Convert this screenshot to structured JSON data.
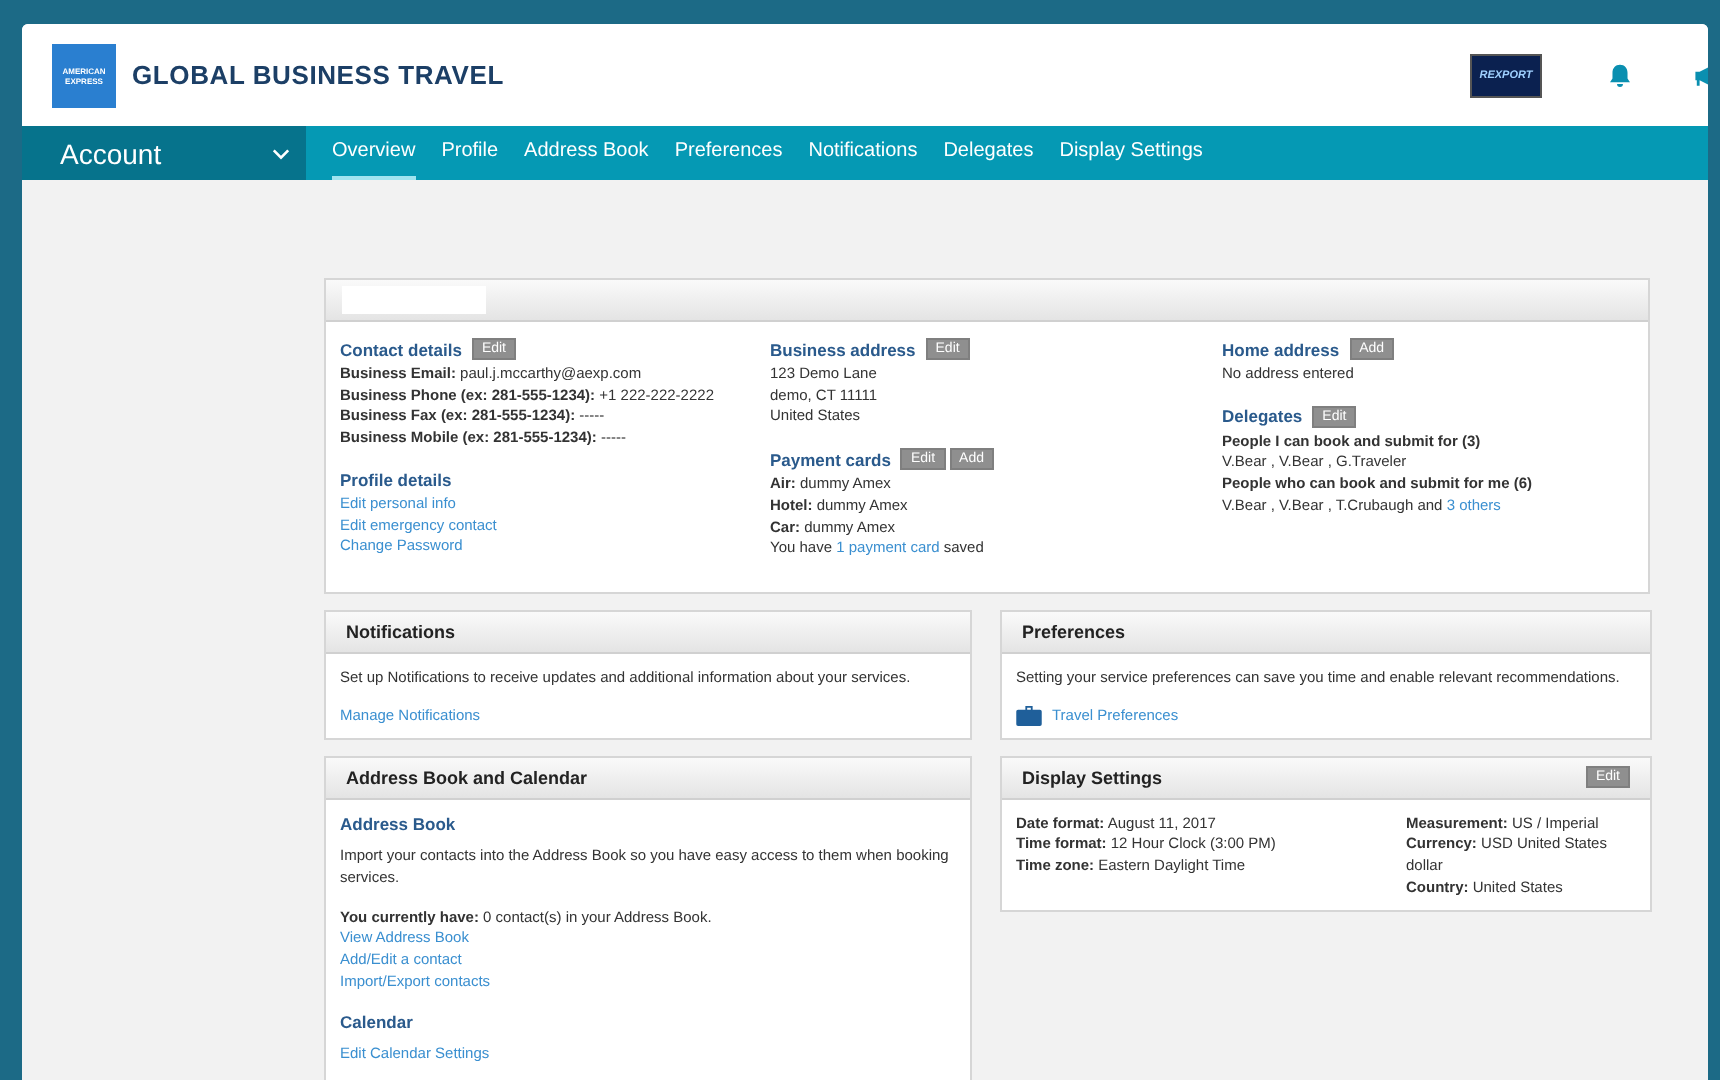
{
  "header": {
    "logo_lines": [
      "AMERICAN",
      "EXPRESS"
    ],
    "brand": "GLOBAL BUSINESS TRAVEL",
    "badge": "REXPORT"
  },
  "nav": {
    "account": "Account",
    "tabs": [
      {
        "label": "Overview",
        "selected": true
      },
      {
        "label": "Profile",
        "selected": false
      },
      {
        "label": "Address Book",
        "selected": false
      },
      {
        "label": "Preferences",
        "selected": false
      },
      {
        "label": "Notifications",
        "selected": false
      },
      {
        "label": "Delegates",
        "selected": false
      },
      {
        "label": "Display Settings",
        "selected": false
      }
    ]
  },
  "profile_card": {
    "columns": [
      [
        {
          "title": "Contact details",
          "buttons": [
            "Edit"
          ],
          "lines": [
            {
              "kind": "text",
              "text": "**Business Email:** paul.j.mccarthy@aexp.com"
            },
            {
              "kind": "text",
              "text": "**Business Phone (ex: 281-555-1234):** +1 222-222-2222"
            },
            {
              "kind": "text",
              "text": "**Business Fax (ex: 281-555-1234):** -----"
            },
            {
              "kind": "text",
              "text": "**Business Mobile (ex: 281-555-1234):** -----"
            }
          ]
        },
        {
          "title": "Profile details",
          "lines": [
            {
              "kind": "link",
              "text": "Edit personal info"
            },
            {
              "kind": "link",
              "text": "Edit emergency contact"
            },
            {
              "kind": "link",
              "text": "Change Password"
            }
          ]
        }
      ],
      [
        {
          "title": "Business address",
          "buttons": [
            "Edit"
          ],
          "lines": [
            {
              "kind": "text",
              "text": "123 Demo Lane"
            },
            {
              "kind": "text",
              "text": "demo, CT 11111"
            },
            {
              "kind": "text",
              "text": "United States"
            }
          ]
        },
        {
          "title": "Payment cards",
          "buttons": [
            "Edit",
            "Add"
          ],
          "lines": [
            {
              "kind": "text",
              "text": "**Air:** dummy Amex"
            },
            {
              "kind": "text",
              "text": "**Hotel:** dummy Amex"
            },
            {
              "kind": "text",
              "text": "**Car:** dummy Amex"
            },
            {
              "kind": "mixed",
              "text": "You have ",
              "link": "1 payment card",
              "after": " saved"
            }
          ]
        }
      ],
      [
        {
          "title": "Home address",
          "buttons": [
            "Add"
          ],
          "lines": [
            {
              "kind": "text",
              "text": "No address entered"
            }
          ]
        },
        {
          "title": "Delegates",
          "buttons": [
            "Edit"
          ],
          "lines": [
            {
              "kind": "text",
              "text": "**People I can book and submit for (3)**"
            },
            {
              "kind": "text",
              "text": "V.Bear , V.Bear , G.Traveler"
            },
            {
              "kind": "text",
              "text": "**People who can book and submit for me (6)**"
            },
            {
              "kind": "mixed",
              "text": "V.Bear , V.Bear , T.Crubaugh  and ",
              "link": "3 others"
            }
          ]
        }
      ]
    ]
  },
  "notifications": {
    "title": "Notifications",
    "text": "Set up Notifications to receive updates and additional information about your services.",
    "link": "Manage Notifications"
  },
  "address_book": {
    "title": "Address Book and Calendar",
    "sections": [
      {
        "heading": "Address Book",
        "lines": [
          {
            "kind": "para",
            "text": "Import your contacts into the Address Book so you have easy access to them when booking services."
          },
          {
            "kind": "text",
            "text": "**You currently have:** 0 contact(s) in your Address Book."
          },
          {
            "kind": "link",
            "text": "View Address Book"
          },
          {
            "kind": "link",
            "text": "Add/Edit a contact"
          },
          {
            "kind": "link",
            "text": "Import/Export contacts"
          }
        ]
      },
      {
        "heading": "Calendar",
        "lines": [
          {
            "kind": "link",
            "text": "Edit Calendar Settings"
          }
        ]
      }
    ]
  },
  "preferences": {
    "title": "Preferences",
    "text": "Setting your service preferences can save you time and enable relevant recommendations.",
    "link": "Travel Preferences"
  },
  "display_settings": {
    "title": "Display Settings",
    "button": "Edit",
    "columns": [
      [
        "**Date format:** August 11, 2017",
        "**Time format:** 12 Hour Clock (3:00 PM)",
        "**Time zone:** Eastern Daylight Time"
      ],
      [
        "**Measurement:** US / Imperial",
        "**Currency:** USD  United States dollar",
        "**Country:** United States"
      ]
    ]
  }
}
